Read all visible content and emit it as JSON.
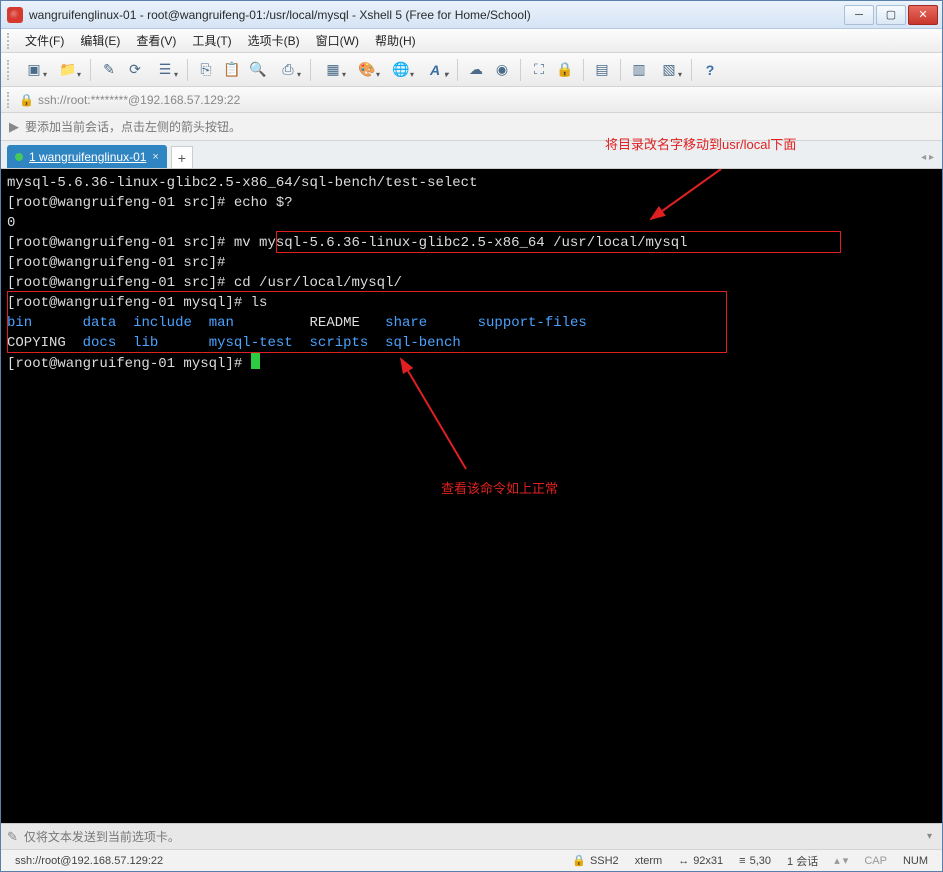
{
  "window": {
    "title": "wangruifenglinux-01 - root@wangruifeng-01:/usr/local/mysql - Xshell 5 (Free for Home/School)"
  },
  "menus": {
    "file": "文件(F)",
    "edit": "编辑(E)",
    "view": "查看(V)",
    "tools": "工具(T)",
    "tabs": "选项卡(B)",
    "window": "窗口(W)",
    "help": "帮助(H)"
  },
  "address": {
    "text": "ssh://root:********@192.168.57.129:22"
  },
  "info": {
    "text": "要添加当前会话，点击左侧的箭头按钮。"
  },
  "tab": {
    "label": "1 wangruifenglinux-01"
  },
  "annotations": {
    "top": "将目录改名字移动到usr/local下面",
    "bottom": "查看该命令如上正常"
  },
  "terminal": {
    "line1": "mysql-5.6.36-linux-glibc2.5-x86_64/sql-bench/test-select",
    "prompt_src": "[root@wangruifeng-01 src]#",
    "prompt_mysql": "[root@wangruifeng-01 mysql]#",
    "cmd_echo": "echo $?",
    "echo_result": "0",
    "cmd_mv": "mv mysql-5.6.36-linux-glibc2.5-x86_64 /usr/local/mysql",
    "cmd_cd": "cd /usr/local/mysql/",
    "cmd_ls": "ls",
    "ls_row1": {
      "c1": "bin",
      "c2": "data",
      "c3": "include",
      "c4": "man",
      "c5": "README",
      "c6": "share",
      "c7": "support-files"
    },
    "ls_row2": {
      "c1": "COPYING",
      "c2": "docs",
      "c3": "lib",
      "c4": "mysql-test",
      "c5": "scripts",
      "c6": "sql-bench"
    }
  },
  "inputbar": {
    "placeholder": "仅将文本发送到当前选项卡。"
  },
  "status": {
    "left": "ssh://root@192.168.57.129:22",
    "ssh": "SSH2",
    "term": "xterm",
    "size": "92x31",
    "cursor": "5,30",
    "sess_label": "1 会话",
    "caps": "CAP",
    "num": "NUM"
  },
  "icons": {
    "win_min": "─",
    "win_max": "▢",
    "win_close": "✕",
    "new": "▣",
    "folder": "📁",
    "disconnect": "✎",
    "reconn": "⟳",
    "props": "☰",
    "copy": "⎘",
    "paste": "📋",
    "find": "🔍",
    "print": "⎙",
    "screen": "▦",
    "palette": "🎨",
    "globe": "🌐",
    "font": "A",
    "cloud": "☁",
    "dash": "◉",
    "fit": "⛶",
    "lock": "🔒",
    "layout": "▤",
    "view1": "▥",
    "view2": "▧",
    "help": "?",
    "addr_lock": "🔒",
    "info": "▶",
    "input": "✎",
    "plus": "+",
    "ssh": "🔒",
    "sizeicon": "↔",
    "cursoricon": "≡",
    "arrows_lr": "◂ ▸",
    "arrows_ud": "▴ ▾"
  }
}
